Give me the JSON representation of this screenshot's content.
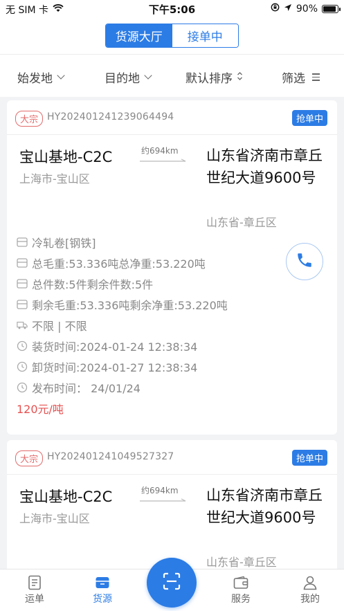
{
  "status_bar": {
    "carrier": "无 SIM 卡",
    "time": "下午5:06",
    "battery": "90%",
    "battery_level": 0.9
  },
  "header": {
    "tabs": [
      {
        "label": "货源大厅",
        "active": true
      },
      {
        "label": "接单中",
        "active": false
      }
    ]
  },
  "filters": {
    "origin": "始发地",
    "destination": "目的地",
    "sort": "默认排序",
    "filter": "筛选"
  },
  "cards": [
    {
      "tag": "大宗",
      "order_no": "HY202401241239064494",
      "status": "抢单中",
      "from_place": "宝山基地-C2C",
      "from_region": "上海市-宝山区",
      "distance": "约694km",
      "to_place": "山东省济南市章丘世纪大道9600号",
      "to_region": "山东省-章丘区",
      "goods": "冷轧卷[钢铁]",
      "weight": "总毛重:53.336吨总净重:53.220吨",
      "pieces": "总件数:5件剩余件数:5件",
      "remaining_weight": "剩余毛重:53.336吨剩余净重:53.220吨",
      "vehicle": "不限 | 不限",
      "load_time": "装货时间:2024-01-24 12:38:34",
      "unload_time": "卸货时间:2024-01-27 12:38:34",
      "publish_time": "发布时间：  24/01/24",
      "price": "120元/吨"
    },
    {
      "tag": "大宗",
      "order_no": "HY202401241049527327",
      "status": "抢单中",
      "from_place": "宝山基地-C2C",
      "from_region": "上海市-宝山区",
      "distance": "约694km",
      "to_place": "山东省济南市章丘世纪大道9600号",
      "to_region": "山东省-章丘区"
    }
  ],
  "tabbar": {
    "items": [
      {
        "label": "运单",
        "icon": "document-icon"
      },
      {
        "label": "货源",
        "icon": "cargo-icon",
        "active": true
      },
      {
        "label": "",
        "icon": "scan-icon"
      },
      {
        "label": "服务",
        "icon": "wallet-icon"
      },
      {
        "label": "我的",
        "icon": "user-icon"
      }
    ]
  },
  "colors": {
    "primary": "#2c7ce5",
    "price": "#e65050",
    "tag": "#e36b6b"
  }
}
